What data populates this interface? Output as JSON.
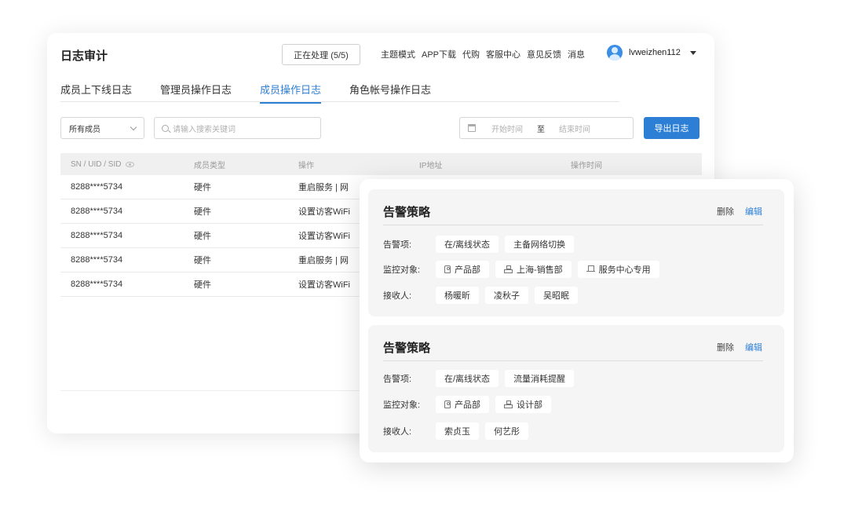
{
  "page": {
    "title": "日志审计",
    "processing_label": "正在处理 (5/5)"
  },
  "top_nav": [
    "主题模式",
    "APP下载",
    "代购",
    "客服中心",
    "意见反馈",
    "消息"
  ],
  "user": {
    "name": "lvweizhen112"
  },
  "tabs": [
    {
      "label": "成员上下线日志",
      "active": false
    },
    {
      "label": "管理员操作日志",
      "active": false
    },
    {
      "label": "成员操作日志",
      "active": true
    },
    {
      "label": "角色帐号操作日志",
      "active": false
    }
  ],
  "filters": {
    "member_select": "所有成员",
    "search_placeholder": "请输入搜索关键词",
    "start_time": "开始时间",
    "date_sep": "至",
    "end_time": "结束时间",
    "export_label": "导出日志"
  },
  "table": {
    "headers": [
      "SN / UID / SID",
      "成员类型",
      "操作",
      "IP地址",
      "操作时间"
    ],
    "rows": [
      [
        "8288****5734",
        "硬件",
        "重启服务 | 网",
        "",
        ""
      ],
      [
        "8288****5734",
        "硬件",
        "设置访客WiFi",
        "",
        ""
      ],
      [
        "8288****5734",
        "硬件",
        "设置访客WiFi",
        "",
        ""
      ],
      [
        "8288****5734",
        "硬件",
        "重启服务 | 网",
        "",
        ""
      ],
      [
        "8288****5734",
        "硬件",
        "设置访客WiFi",
        "",
        ""
      ]
    ]
  },
  "policies": [
    {
      "title": "告警策略",
      "delete_label": "删除",
      "edit_label": "编辑",
      "items_label": "告警项:",
      "items": [
        "在/离线状态",
        "主备网络切换"
      ],
      "targets_label": "监控对象:",
      "targets": [
        {
          "icon": "tag-icon",
          "label": "产品部"
        },
        {
          "icon": "org-icon",
          "label": "上海-销售部"
        },
        {
          "icon": "desk-icon",
          "label": "服务中心专用"
        }
      ],
      "receivers_label": "接收人:",
      "receivers": [
        "杨暖昕",
        "凌秋子",
        "吴昭眠"
      ]
    },
    {
      "title": "告警策略",
      "delete_label": "删除",
      "edit_label": "编辑",
      "items_label": "告警项:",
      "items": [
        "在/离线状态",
        "流量消耗提醒"
      ],
      "targets_label": "监控对象:",
      "targets": [
        {
          "icon": "tag-icon",
          "label": "产品部"
        },
        {
          "icon": "org-icon",
          "label": "设计部"
        }
      ],
      "receivers_label": "接收人:",
      "receivers": [
        "索贞玉",
        "何艺彤"
      ]
    }
  ],
  "colors": {
    "accent": "#2d7fd6"
  }
}
